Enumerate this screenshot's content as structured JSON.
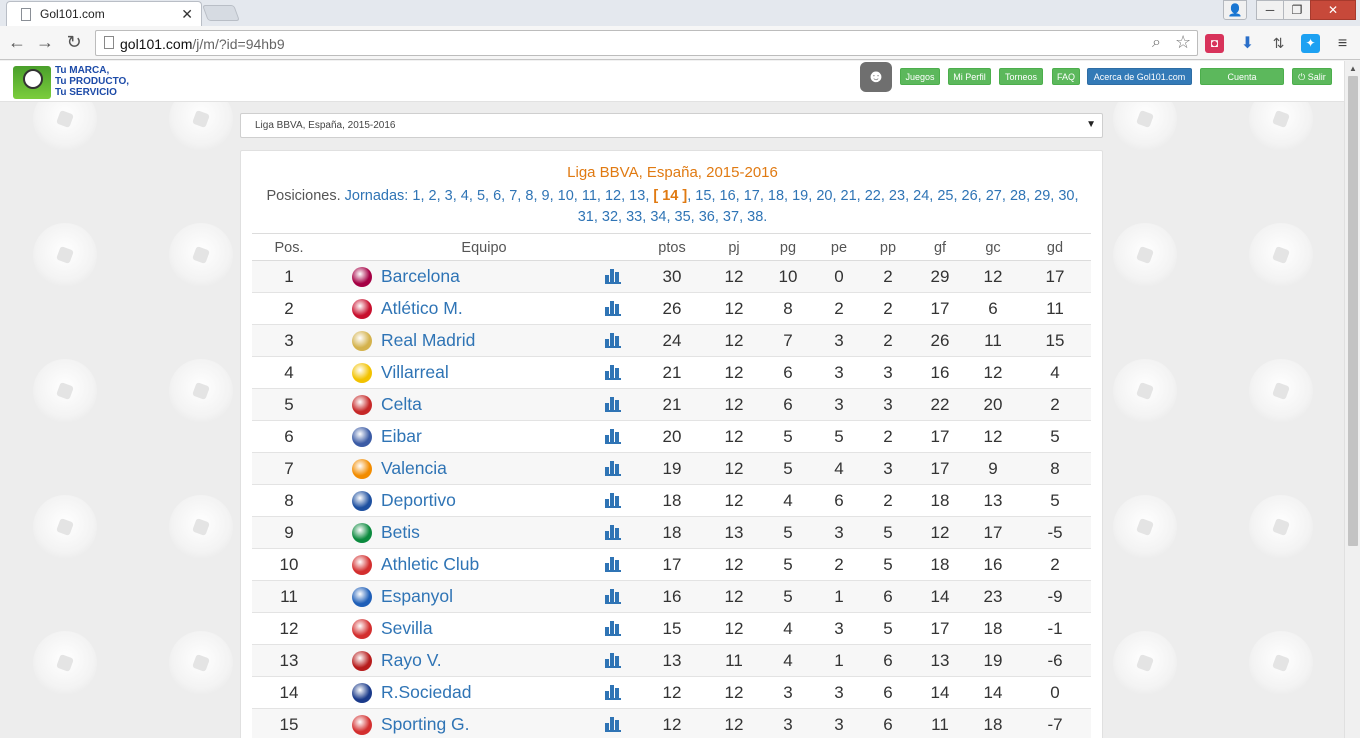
{
  "browser": {
    "tab_title": "Gol101.com",
    "url_host": "gol101.com",
    "url_path": "/j/m/?id=94hb9"
  },
  "header": {
    "logo_lines": [
      "Tu MARCA,",
      "Tu  PRODUCTO,",
      "Tu SERVICIO"
    ],
    "nav": [
      "Juegos",
      "Mi Perfil",
      "Torneos",
      "FAQ",
      "Acerca de Gol101.com",
      "Cuenta PREMIUM",
      "Salir"
    ]
  },
  "select": {
    "value": "Liga BBVA, España, 2015-2016"
  },
  "league": {
    "title": "Liga BBVA, España, 2015-2016",
    "positions_label": "Posiciones.",
    "rounds_label": "Jornadas:",
    "rounds": [
      "1",
      "2",
      "3",
      "4",
      "5",
      "6",
      "7",
      "8",
      "9",
      "10",
      "11",
      "12",
      "13",
      "14",
      "15",
      "16",
      "17",
      "18",
      "19",
      "20",
      "21",
      "22",
      "23",
      "24",
      "25",
      "26",
      "27",
      "28",
      "29",
      "30",
      "31",
      "32",
      "33",
      "34",
      "35",
      "36",
      "37",
      "38"
    ],
    "current_round": "14"
  },
  "table": {
    "headers": [
      "Pos.",
      "Equipo",
      "ptos",
      "pj",
      "pg",
      "pe",
      "pp",
      "gf",
      "gc",
      "gd"
    ],
    "rows": [
      {
        "pos": "1",
        "team": "Barcelona",
        "ptos": "30",
        "pj": "12",
        "pg": "10",
        "pe": "0",
        "pp": "2",
        "gf": "29",
        "gc": "12",
        "gd": "17",
        "crest": "#a50044"
      },
      {
        "pos": "2",
        "team": "Atlético M.",
        "ptos": "26",
        "pj": "12",
        "pg": "8",
        "pe": "2",
        "pp": "2",
        "gf": "17",
        "gc": "6",
        "gd": "11",
        "crest": "#c8102e"
      },
      {
        "pos": "3",
        "team": "Real Madrid",
        "ptos": "24",
        "pj": "12",
        "pg": "7",
        "pe": "3",
        "pp": "2",
        "gf": "26",
        "gc": "11",
        "gd": "15",
        "crest": "#d4b24c"
      },
      {
        "pos": "4",
        "team": "Villarreal",
        "ptos": "21",
        "pj": "12",
        "pg": "6",
        "pe": "3",
        "pp": "3",
        "gf": "16",
        "gc": "12",
        "gd": "4",
        "crest": "#f2c200"
      },
      {
        "pos": "5",
        "team": "Celta",
        "ptos": "21",
        "pj": "12",
        "pg": "6",
        "pe": "3",
        "pp": "3",
        "gf": "22",
        "gc": "20",
        "gd": "2",
        "crest": "#c62828"
      },
      {
        "pos": "6",
        "team": "Eibar",
        "ptos": "20",
        "pj": "12",
        "pg": "5",
        "pe": "5",
        "pp": "2",
        "gf": "17",
        "gc": "12",
        "gd": "5",
        "crest": "#3b5ba5"
      },
      {
        "pos": "7",
        "team": "Valencia",
        "ptos": "19",
        "pj": "12",
        "pg": "5",
        "pe": "4",
        "pp": "3",
        "gf": "17",
        "gc": "9",
        "gd": "8",
        "crest": "#f28c00"
      },
      {
        "pos": "8",
        "team": "Deportivo",
        "ptos": "18",
        "pj": "12",
        "pg": "4",
        "pe": "6",
        "pp": "2",
        "gf": "18",
        "gc": "13",
        "gd": "5",
        "crest": "#1e50a0"
      },
      {
        "pos": "9",
        "team": "Betis",
        "ptos": "18",
        "pj": "13",
        "pg": "5",
        "pe": "3",
        "pp": "5",
        "gf": "12",
        "gc": "17",
        "gd": "-5",
        "crest": "#0b8a3e"
      },
      {
        "pos": "10",
        "team": "Athletic Club",
        "ptos": "17",
        "pj": "12",
        "pg": "5",
        "pe": "2",
        "pp": "5",
        "gf": "18",
        "gc": "16",
        "gd": "2",
        "crest": "#d32f2f"
      },
      {
        "pos": "11",
        "team": "Espanyol",
        "ptos": "16",
        "pj": "12",
        "pg": "5",
        "pe": "1",
        "pp": "6",
        "gf": "14",
        "gc": "23",
        "gd": "-9",
        "crest": "#1f5fb8"
      },
      {
        "pos": "12",
        "team": "Sevilla",
        "ptos": "15",
        "pj": "12",
        "pg": "4",
        "pe": "3",
        "pp": "5",
        "gf": "17",
        "gc": "18",
        "gd": "-1",
        "crest": "#d32f2f"
      },
      {
        "pos": "13",
        "team": "Rayo V.",
        "ptos": "13",
        "pj": "11",
        "pg": "4",
        "pe": "1",
        "pp": "6",
        "gf": "13",
        "gc": "19",
        "gd": "-6",
        "crest": "#b71c1c"
      },
      {
        "pos": "14",
        "team": "R.Sociedad",
        "ptos": "12",
        "pj": "12",
        "pg": "3",
        "pe": "3",
        "pp": "6",
        "gf": "14",
        "gc": "14",
        "gd": "0",
        "crest": "#1a3a8a"
      },
      {
        "pos": "15",
        "team": "Sporting G.",
        "ptos": "12",
        "pj": "12",
        "pg": "3",
        "pe": "3",
        "pp": "6",
        "gf": "11",
        "gc": "18",
        "gd": "-7",
        "crest": "#d32f2f"
      }
    ]
  }
}
